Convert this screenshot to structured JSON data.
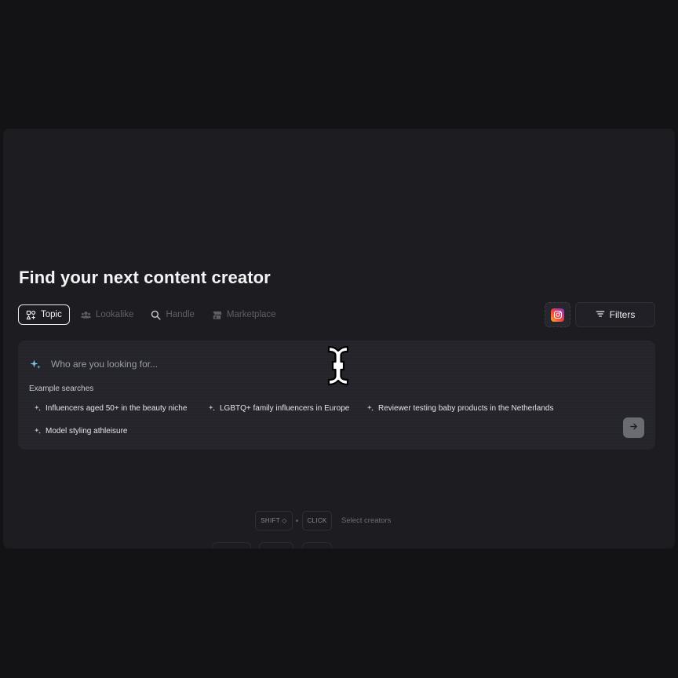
{
  "header": {
    "title": "Find your next content creator"
  },
  "tabs": [
    {
      "label": "Topic",
      "icon": "topic-icon",
      "active": true
    },
    {
      "label": "Lookalike",
      "icon": "users-icon",
      "active": false
    },
    {
      "label": "Handle",
      "icon": "search-icon",
      "active": false
    },
    {
      "label": "Marketplace",
      "icon": "storefront-icon",
      "active": false
    }
  ],
  "platform": {
    "icon": "instagram-icon"
  },
  "filters": {
    "label": "Filters",
    "icon": "filter-lines-icon"
  },
  "search": {
    "placeholder": "Who are you looking for...",
    "value": "",
    "example_label": "Example searches",
    "examples": [
      "Influencers aged 50+ in the beauty niche",
      "LGBTQ+ family influencers in Europe",
      "Reviewer testing baby products in the Netherlands",
      "Model styling athleisure"
    ],
    "submit_icon": "arrow-right-icon"
  },
  "shortcut": {
    "keys": [
      "SHIFT ◇",
      "CLICK"
    ],
    "description": "Select creators"
  },
  "colors": {
    "background": "#131315",
    "panel": "#1c1c21",
    "search_box": "#26262d",
    "sparkle_accent": "#7fc6e8",
    "text_primary": "#f4f4f6",
    "text_muted": "#5f5f68"
  }
}
